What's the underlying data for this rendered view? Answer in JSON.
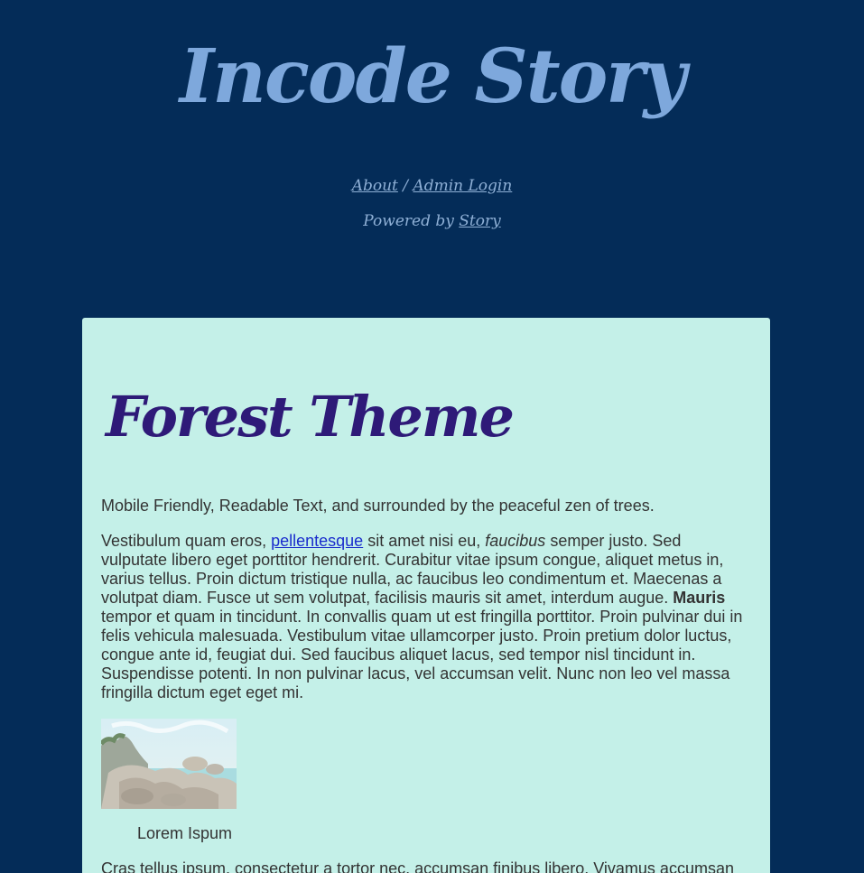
{
  "header": {
    "title": "Incode Story",
    "nav_about": "About",
    "nav_separator": "/",
    "nav_admin": "Admin Login",
    "powered_prefix": "Powered by",
    "powered_link": "Story"
  },
  "post": {
    "title": "Forest Theme",
    "intro": "Mobile Friendly, Readable Text, and surrounded by the peaceful zen of trees.",
    "p2_a": "Vestibulum quam eros, ",
    "p2_link": "pellentesque",
    "p2_b": " sit amet nisi eu, ",
    "p2_em": "faucibus",
    "p2_c": " semper justo. Sed vulputate libero eget porttitor hendrerit. Curabitur vitae ipsum congue, aliquet metus in, varius tellus. Proin dictum tristique nulla, ac faucibus leo condimentum et. Maecenas a volutpat diam. Fusce ut sem volutpat, facilisis mauris sit amet, interdum augue. ",
    "p2_strong": "Mauris",
    "p2_d": " tempor et quam in tincidunt. In convallis quam ut est fringilla porttitor. Proin pulvinar dui in felis vehicula malesuada. Vestibulum vitae ullamcorper justo. Proin pretium dolor luctus, congue ante id, feugiat dui. Sed faucibus aliquet lacus, sed tempor nisl tincidunt in. Suspendisse potenti. In non pulvinar lacus, vel accumsan velit. Nunc non leo vel massa fringilla dictum eget eget mi.",
    "image_caption": "Lorem Ispum",
    "p3": "Cras tellus ipsum, consectetur a tortor nec, accumsan finibus libero. Vivamus accumsan"
  },
  "colors": {
    "background": "#042c58",
    "header_text": "#7ea8dc",
    "card": "#c4f0e8",
    "post_title": "#2e1a78",
    "body_text": "#333333",
    "link": "#1a2ccd"
  }
}
